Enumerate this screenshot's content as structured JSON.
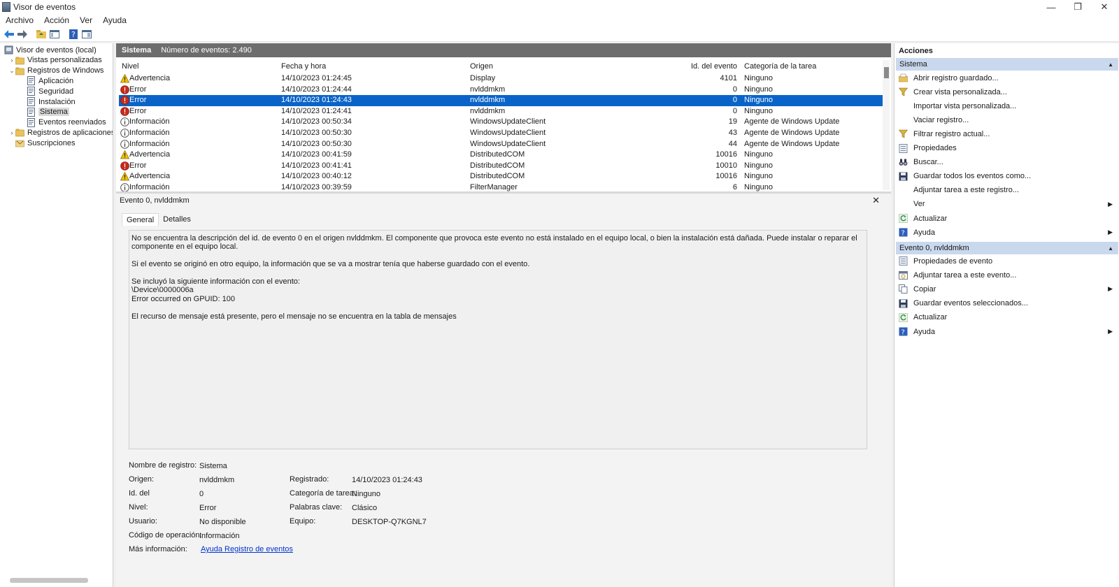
{
  "window": {
    "title": "Visor de eventos",
    "controls": [
      "—",
      "❐",
      "✕"
    ]
  },
  "menu": [
    "Archivo",
    "Acción",
    "Ver",
    "Ayuda"
  ],
  "tree": [
    {
      "label": "Visor de eventos (local)",
      "level": 0,
      "chev": "",
      "icon": "computer-icon"
    },
    {
      "label": "Vistas personalizadas",
      "level": 1,
      "chev": "›",
      "icon": "folder-icon"
    },
    {
      "label": "Registros de Windows",
      "level": 1,
      "chev": "⌄",
      "icon": "folder-icon"
    },
    {
      "label": "Aplicación",
      "level": 2,
      "chev": "",
      "icon": "log-icon"
    },
    {
      "label": "Seguridad",
      "level": 2,
      "chev": "",
      "icon": "log-icon"
    },
    {
      "label": "Instalación",
      "level": 2,
      "chev": "",
      "icon": "log-icon"
    },
    {
      "label": "Sistema",
      "level": 2,
      "chev": "",
      "icon": "log-icon",
      "selected": true
    },
    {
      "label": "Eventos reenviados",
      "level": 2,
      "chev": "",
      "icon": "log-icon"
    },
    {
      "label": "Registros de aplicaciones y se",
      "level": 1,
      "chev": "›",
      "icon": "folder-icon"
    },
    {
      "label": "Suscripciones",
      "level": 1,
      "chev": "",
      "icon": "subscriptions-icon"
    }
  ],
  "list": {
    "log_name": "Sistema",
    "count_text": "Número de eventos: 2.490",
    "columns": {
      "level": "Nivel",
      "date": "Fecha y hora",
      "source": "Origen",
      "id": "Id. del evento",
      "category": "Categoría de la tarea"
    },
    "rows": [
      {
        "type": "warning",
        "level": "Advertencia",
        "date": "14/10/2023 01:24:45",
        "source": "Display",
        "id": "4101",
        "category": "Ninguno"
      },
      {
        "type": "error",
        "level": "Error",
        "date": "14/10/2023 01:24:44",
        "source": "nvlddmkm",
        "id": "0",
        "category": "Ninguno"
      },
      {
        "type": "error",
        "level": "Error",
        "date": "14/10/2023 01:24:43",
        "source": "nvlddmkm",
        "id": "0",
        "category": "Ninguno",
        "selected": true
      },
      {
        "type": "error",
        "level": "Error",
        "date": "14/10/2023 01:24:41",
        "source": "nvlddmkm",
        "id": "0",
        "category": "Ninguno"
      },
      {
        "type": "info",
        "level": "Información",
        "date": "14/10/2023 00:50:34",
        "source": "WindowsUpdateClient",
        "id": "19",
        "category": "Agente de Windows Update"
      },
      {
        "type": "info",
        "level": "Información",
        "date": "14/10/2023 00:50:30",
        "source": "WindowsUpdateClient",
        "id": "43",
        "category": "Agente de Windows Update"
      },
      {
        "type": "info",
        "level": "Información",
        "date": "14/10/2023 00:50:30",
        "source": "WindowsUpdateClient",
        "id": "44",
        "category": "Agente de Windows Update"
      },
      {
        "type": "warning",
        "level": "Advertencia",
        "date": "14/10/2023 00:41:59",
        "source": "DistributedCOM",
        "id": "10016",
        "category": "Ninguno"
      },
      {
        "type": "error",
        "level": "Error",
        "date": "14/10/2023 00:41:41",
        "source": "DistributedCOM",
        "id": "10010",
        "category": "Ninguno"
      },
      {
        "type": "warning",
        "level": "Advertencia",
        "date": "14/10/2023 00:40:12",
        "source": "DistributedCOM",
        "id": "10016",
        "category": "Ninguno"
      },
      {
        "type": "info",
        "level": "Información",
        "date": "14/10/2023 00:39:59",
        "source": "FilterManager",
        "id": "6",
        "category": "Ninguno"
      }
    ]
  },
  "detail": {
    "title": "Evento 0, nvlddmkm",
    "close": "✕",
    "tabs": [
      "General",
      "Detalles"
    ],
    "description": [
      "No se encuentra la descripción del id. de evento 0 en el origen nvlddmkm. El componente que provoca este evento no está instalado en el equipo local, o bien la instalación está dañada. Puede instalar o reparar el componente en el equipo local.",
      "Si el evento se originó en otro equipo, la información que se va a mostrar tenía que haberse guardado con el evento.",
      "Se incluyó la siguiente información con el evento:\n\\Device\\0000006a\nError occurred on GPUID: 100",
      "El recurso de mensaje está presente, pero el mensaje no se encuentra en la tabla de mensajes"
    ],
    "fields": {
      "log_name_label": "Nombre de registro:",
      "log_name": "Sistema",
      "source_label": "Origen:",
      "source": "nvlddmkm",
      "logged_label": "Registrado:",
      "logged": "14/10/2023 01:24:43",
      "id_label": "Id. del",
      "id": "0",
      "category_label": "Categoría de tarea:",
      "category": "Ninguno",
      "level_label": "Nivel:",
      "level": "Error",
      "keywords_label": "Palabras clave:",
      "keywords": "Clásico",
      "user_label": "Usuario:",
      "user": "No disponible",
      "computer_label": "Equipo:",
      "computer": "DESKTOP-Q7KGNL7",
      "opcode_label": "Código de operación:",
      "opcode": "Información",
      "more_label": "Más información:",
      "more_link": "Ayuda Registro de eventos"
    }
  },
  "actions": {
    "title": "Acciones",
    "section1": "Sistema",
    "items1": [
      {
        "label": "Abrir registro guardado...",
        "icon": "open-log-icon"
      },
      {
        "label": "Crear vista personalizada...",
        "icon": "filter-icon"
      },
      {
        "label": "Importar vista personalizada...",
        "icon": ""
      },
      {
        "label": "Vaciar registro...",
        "icon": ""
      },
      {
        "label": "Filtrar registro actual...",
        "icon": "filter-icon"
      },
      {
        "label": "Propiedades",
        "icon": "properties-icon"
      },
      {
        "label": "Buscar...",
        "icon": "binoculars-icon"
      },
      {
        "label": "Guardar todos los eventos como...",
        "icon": "save-icon"
      },
      {
        "label": "Adjuntar tarea a este registro...",
        "icon": ""
      },
      {
        "label": "Ver",
        "icon": "",
        "submenu": true
      },
      {
        "label": "Actualizar",
        "icon": "refresh-icon"
      },
      {
        "label": "Ayuda",
        "icon": "help-icon",
        "submenu": true
      }
    ],
    "section2": "Evento 0, nvlddmkm",
    "items2": [
      {
        "label": "Propiedades de evento",
        "icon": "properties-icon"
      },
      {
        "label": "Adjuntar tarea a este evento...",
        "icon": "task-icon"
      },
      {
        "label": "Copiar",
        "icon": "copy-icon",
        "submenu": true
      },
      {
        "label": "Guardar eventos seleccionados...",
        "icon": "save-icon"
      },
      {
        "label": "Actualizar",
        "icon": "refresh-icon"
      },
      {
        "label": "Ayuda",
        "icon": "help-icon",
        "submenu": true
      }
    ]
  }
}
